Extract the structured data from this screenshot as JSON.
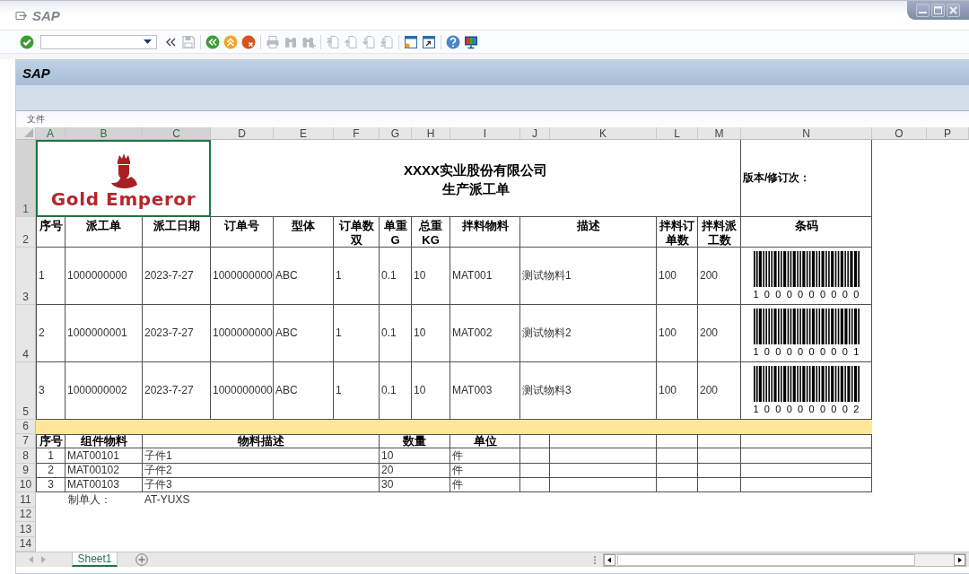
{
  "window": {
    "title": "SAP"
  },
  "toolbar": {
    "groups": [
      [
        {
          "kind": "enter",
          "disabled": false
        },
        {
          "kind": "command-field",
          "disabled": false
        },
        {
          "kind": "collapse",
          "disabled": false
        },
        {
          "kind": "save",
          "disabled": true
        }
      ],
      [
        {
          "kind": "back",
          "disabled": false
        },
        {
          "kind": "exit",
          "disabled": false
        },
        {
          "kind": "cancel",
          "disabled": false
        }
      ],
      [
        {
          "kind": "print",
          "disabled": true
        },
        {
          "kind": "find",
          "disabled": true
        },
        {
          "kind": "find-next",
          "disabled": true
        }
      ],
      [
        {
          "kind": "first-page",
          "disabled": true
        },
        {
          "kind": "previous-page",
          "disabled": true
        },
        {
          "kind": "next-page",
          "disabled": true
        },
        {
          "kind": "last-page",
          "disabled": true
        }
      ],
      [
        {
          "kind": "new-session",
          "disabled": false
        },
        {
          "kind": "shortcut",
          "disabled": false
        }
      ],
      [
        {
          "kind": "help",
          "disabled": false
        },
        {
          "kind": "layout",
          "disabled": false
        }
      ]
    ]
  },
  "panel": {
    "title": "SAP",
    "menu": [
      "文件"
    ]
  },
  "sheet": {
    "columns": [
      {
        "label": "A",
        "selected": true
      },
      {
        "label": "B",
        "selected": true
      },
      {
        "label": "C",
        "selected": true
      },
      {
        "label": "D",
        "selected": false
      },
      {
        "label": "E",
        "selected": false
      },
      {
        "label": "F",
        "selected": false
      },
      {
        "label": "G",
        "selected": false
      },
      {
        "label": "H",
        "selected": false
      },
      {
        "label": "I",
        "selected": false
      },
      {
        "label": "J",
        "selected": false
      },
      {
        "label": "K",
        "selected": false
      },
      {
        "label": "L",
        "selected": false
      },
      {
        "label": "M",
        "selected": false
      },
      {
        "label": "N",
        "selected": false
      },
      {
        "label": "O",
        "selected": false
      },
      {
        "label": "P",
        "selected": false
      }
    ],
    "rows": [
      {
        "label": "1",
        "selected": true
      },
      {
        "label": "2",
        "selected": false
      },
      {
        "label": "3",
        "selected": false
      },
      {
        "label": "4",
        "selected": false
      },
      {
        "label": "5",
        "selected": false
      },
      {
        "label": "6",
        "selected": false
      },
      {
        "label": "7",
        "selected": false
      },
      {
        "label": "8",
        "selected": false
      },
      {
        "label": "9",
        "selected": false
      },
      {
        "label": "10",
        "selected": false
      },
      {
        "label": "11",
        "selected": false
      },
      {
        "label": "12",
        "selected": false
      },
      {
        "label": "13",
        "selected": false
      },
      {
        "label": "14",
        "selected": false
      }
    ],
    "header": {
      "logo": {
        "text": "Gold Emperor",
        "selected": true
      },
      "company": "XXXX实业股份有限公司",
      "title": "生产派工单",
      "version_label": "版本/修订次："
    },
    "order_table": {
      "columns": [
        "序号",
        "派工单",
        "派工日期",
        "订单号",
        "型体",
        "订单数双",
        "单重G",
        "总重KG",
        "拌料物料",
        "描述",
        "拌料订单数",
        "拌料派工数",
        "条码"
      ],
      "rows": [
        {
          "cells": [
            "1",
            "1000000000",
            "2023-7-27",
            "1000000000",
            "ABC",
            "1",
            "0.1",
            "10",
            "MAT001",
            "测试物料1",
            "100",
            "200"
          ],
          "barcode": "1000000000"
        },
        {
          "cells": [
            "2",
            "1000000001",
            "2023-7-27",
            "1000000000",
            "ABC",
            "1",
            "0.1",
            "10",
            "MAT002",
            "测试物料2",
            "100",
            "200"
          ],
          "barcode": "1000000001"
        },
        {
          "cells": [
            "3",
            "1000000002",
            "2023-7-27",
            "1000000000",
            "ABC",
            "1",
            "0.1",
            "10",
            "MAT003",
            "测试物料3",
            "100",
            "200"
          ],
          "barcode": "1000000002"
        }
      ]
    },
    "component_table": {
      "columns": [
        "序号",
        "组件物料",
        "物料描述",
        "数量",
        "单位"
      ],
      "rows": [
        [
          "1",
          "MAT00101",
          "子件1",
          "10",
          "件"
        ],
        [
          "2",
          "MAT00102",
          "子件2",
          "20",
          "件"
        ],
        [
          "3",
          "MAT00103",
          "子件3",
          "30",
          "件"
        ]
      ]
    },
    "footer": {
      "label": "制单人：",
      "value": "AT-YUXS"
    }
  },
  "sheet_tabs": [
    {
      "label": "Sheet1",
      "selected": true
    }
  ]
}
